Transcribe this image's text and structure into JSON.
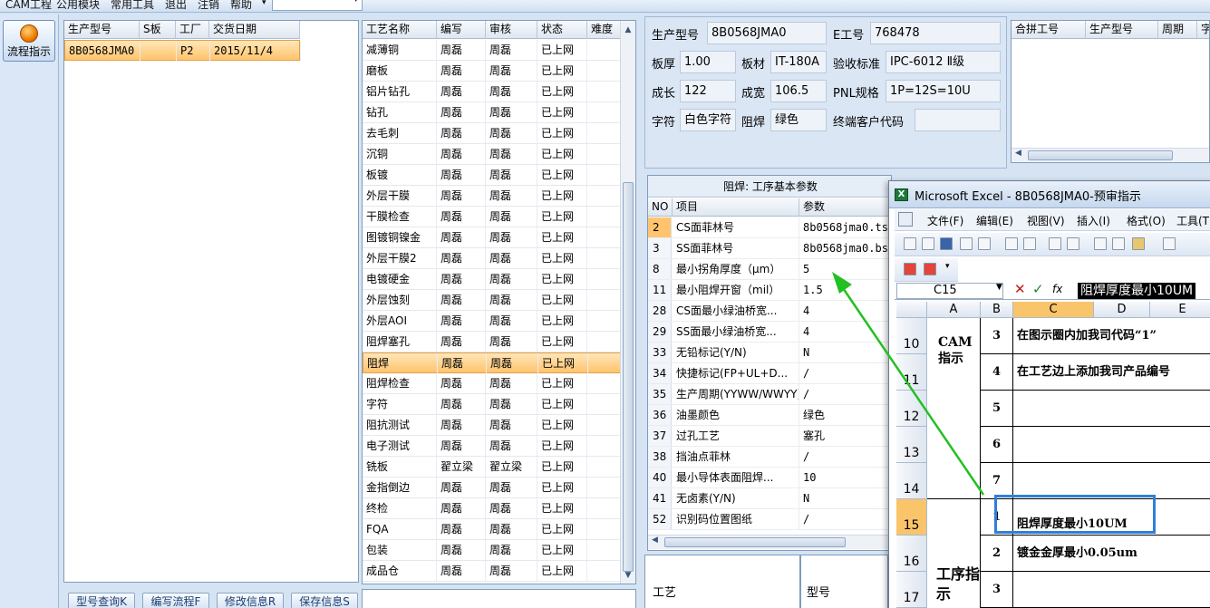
{
  "menu": [
    "CAM工程",
    "公用模块",
    "常用工具",
    "退出",
    "注销",
    "帮助"
  ],
  "nav": {
    "flow_label": "流程指示"
  },
  "order_grid": {
    "headers": [
      "生产型号",
      "S板",
      "工厂",
      "交货日期"
    ],
    "rows": [
      {
        "model": "8B0568JMA0",
        "s": "",
        "factory": "P2",
        "date": "2015/11/4"
      }
    ]
  },
  "process_grid": {
    "headers": [
      "工艺名称",
      "编写",
      "审核",
      "状态",
      "难度"
    ],
    "rows": [
      [
        "减薄铜",
        "周磊",
        "周磊",
        "已上网"
      ],
      [
        "磨板",
        "周磊",
        "周磊",
        "已上网"
      ],
      [
        "铝片钻孔",
        "周磊",
        "周磊",
        "已上网"
      ],
      [
        "钻孔",
        "周磊",
        "周磊",
        "已上网"
      ],
      [
        "去毛刺",
        "周磊",
        "周磊",
        "已上网"
      ],
      [
        "沉铜",
        "周磊",
        "周磊",
        "已上网"
      ],
      [
        "板镀",
        "周磊",
        "周磊",
        "已上网"
      ],
      [
        "外层干膜",
        "周磊",
        "周磊",
        "已上网"
      ],
      [
        "干膜检查",
        "周磊",
        "周磊",
        "已上网"
      ],
      [
        "图镀铜镍金",
        "周磊",
        "周磊",
        "已上网"
      ],
      [
        "外层干膜2",
        "周磊",
        "周磊",
        "已上网"
      ],
      [
        "电镀硬金",
        "周磊",
        "周磊",
        "已上网"
      ],
      [
        "外层蚀刻",
        "周磊",
        "周磊",
        "已上网"
      ],
      [
        "外层AOI",
        "周磊",
        "周磊",
        "已上网"
      ],
      [
        "阻焊塞孔",
        "周磊",
        "周磊",
        "已上网"
      ],
      [
        "阻焊",
        "周磊",
        "周磊",
        "已上网"
      ],
      [
        "阻焊检查",
        "周磊",
        "周磊",
        "已上网"
      ],
      [
        "字符",
        "周磊",
        "周磊",
        "已上网"
      ],
      [
        "阻抗测试",
        "周磊",
        "周磊",
        "已上网"
      ],
      [
        "电子测试",
        "周磊",
        "周磊",
        "已上网"
      ],
      [
        "铣板",
        "翟立梁",
        "翟立梁",
        "已上网"
      ],
      [
        "金指倒边",
        "周磊",
        "周磊",
        "已上网"
      ],
      [
        "终检",
        "周磊",
        "周磊",
        "已上网"
      ],
      [
        "FQA",
        "周磊",
        "周磊",
        "已上网"
      ],
      [
        "包装",
        "周磊",
        "周磊",
        "已上网"
      ],
      [
        "成品仓",
        "周磊",
        "周磊",
        "已上网"
      ]
    ],
    "selected": "阻焊"
  },
  "info": {
    "model_label": "生产型号",
    "model": "8B0568JMA0",
    "eno_label": "E工号",
    "eno": "768478",
    "thick_label": "板厚",
    "thick": "1.00",
    "mat_label": "板材",
    "mat": "IT-180A",
    "std_label": "验收标准",
    "std": "IPC-6012 Ⅱ级",
    "len_label": "成长",
    "len": "122",
    "wid_label": "成宽",
    "wid": "106.5",
    "pnl_label": "PNL规格",
    "pnl": "1P=12S=10U",
    "char_label": "字符",
    "char": "白色字符",
    "sm_label": "阻焊",
    "sm": "绿色",
    "cust_label": "终端客户代码",
    "cust": ""
  },
  "combine_grid": {
    "headers": [
      "合拼工号",
      "生产型号",
      "周期",
      "字"
    ]
  },
  "params": {
    "title": "阻焊: 工序基本参数",
    "headers": [
      "NO",
      "项目",
      "参数"
    ],
    "rows": [
      [
        "2",
        "CS面菲林号",
        "8b0568jma0.ts"
      ],
      [
        "3",
        "SS面菲林号",
        "8b0568jma0.bs"
      ],
      [
        "8",
        "最小拐角厚度（μm）",
        "5"
      ],
      [
        "11",
        "最小阻焊开窗（mil）",
        "1.5"
      ],
      [
        "28",
        "CS面最小绿油桥宽...",
        "4"
      ],
      [
        "29",
        "SS面最小绿油桥宽...",
        "4"
      ],
      [
        "33",
        "无铅标记(Y/N)",
        "N"
      ],
      [
        "34",
        "快捷标记(FP+UL+D...",
        "/"
      ],
      [
        "35",
        "生产周期(YYWW/WWYY)",
        "/"
      ],
      [
        "36",
        "油墨颜色",
        "绿色"
      ],
      [
        "37",
        "过孔工艺",
        "塞孔"
      ],
      [
        "38",
        "挡油点菲林",
        "/"
      ],
      [
        "40",
        "最小导体表面阻焊...",
        "10"
      ],
      [
        "41",
        "无卤素(Y/N)",
        "N"
      ],
      [
        "52",
        "识别码位置图纸",
        "/"
      ]
    ]
  },
  "buttons": [
    "型号查询K",
    "编写流程F",
    "修改信息R",
    "保存信息S"
  ],
  "bottom_labels": {
    "left": "工艺",
    "right": "型号"
  },
  "excel": {
    "title": "Microsoft Excel - 8B0568JMA0-预审指示",
    "menu": [
      "文件(F)",
      "编辑(E)",
      "视图(V)",
      "插入(I)",
      "格式(O)",
      "工具(T"
    ],
    "name_box": "C15",
    "formula": "阻焊厚度最小10UM",
    "columns": [
      "A",
      "B",
      "C",
      "D",
      "E"
    ],
    "rows": [
      {
        "num": "10",
        "b": "3",
        "c": "在图示圈内加我司代码“1”"
      },
      {
        "num": "11",
        "b": "4",
        "c": "在工艺边上添加我司产品编号"
      },
      {
        "num": "12",
        "b": "5",
        "c": ""
      },
      {
        "num": "13",
        "b": "6",
        "c": ""
      },
      {
        "num": "14",
        "b": "7",
        "c": ""
      },
      {
        "num": "15",
        "b": "1",
        "c": "阻焊厚度最小10UM"
      },
      {
        "num": "16",
        "b": "2",
        "c": "镀金金厚最小0.05um"
      },
      {
        "num": "17",
        "b": "3",
        "c": ""
      }
    ],
    "group1": "CAM指示",
    "group2": "工序指示"
  },
  "colors": {
    "selection": "#ffc46d",
    "arrow": "#22c022",
    "highlight_box": "#2f7fd8"
  }
}
